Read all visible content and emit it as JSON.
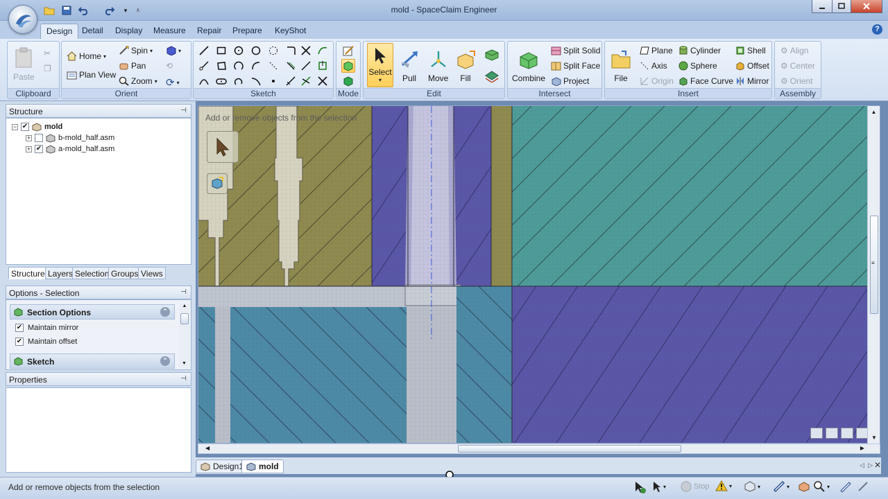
{
  "window": {
    "title": "mold - SpaceClaim Engineer"
  },
  "ribbon_tabs": [
    "Design",
    "Detail",
    "Display",
    "Measure",
    "Repair",
    "Prepare",
    "KeyShot"
  ],
  "clipboard": {
    "paste": "Paste",
    "label": "Clipboard"
  },
  "orient": {
    "home": "Home",
    "plan_view": "Plan View",
    "spin": "Spin",
    "pan": "Pan",
    "zoom": "Zoom",
    "label": "Orient"
  },
  "sketch": {
    "label": "Sketch"
  },
  "mode": {
    "label": "Mode"
  },
  "edit": {
    "select": "Select",
    "pull": "Pull",
    "move": "Move",
    "fill": "Fill",
    "label": "Edit"
  },
  "intersect": {
    "combine": "Combine",
    "split_solid": "Split Solid",
    "split_face": "Split Face",
    "project": "Project",
    "label": "Intersect"
  },
  "insert": {
    "file": "File",
    "plane": "Plane",
    "axis": "Axis",
    "origin": "Origin",
    "cylinder": "Cylinder",
    "sphere": "Sphere",
    "face_curve": "Face Curve",
    "shell": "Shell",
    "offset": "Offset",
    "mirror": "Mirror",
    "label": "Insert"
  },
  "assembly": {
    "align": "Align",
    "center": "Center",
    "orient": "Orient",
    "label": "Assembly"
  },
  "structure_panel": {
    "title": "Structure",
    "tree": [
      {
        "label": "mold",
        "checked": true
      },
      {
        "label": "b-mold_half.asm",
        "checked": false
      },
      {
        "label": "a-mold_half.asm",
        "checked": true
      }
    ],
    "tabs": [
      "Structure",
      "Layers",
      "Selection",
      "Groups",
      "Views"
    ]
  },
  "options_panel": {
    "title": "Options - Selection",
    "section_options": "Section Options",
    "maintain_mirror": "Maintain mirror",
    "maintain_offset": "Maintain offset",
    "sketch": "Sketch"
  },
  "properties_panel": {
    "title": "Properties"
  },
  "viewport": {
    "hint": "Add or remove objects from the selection"
  },
  "doc_tabs": [
    "Design1",
    "mold"
  ],
  "status": {
    "text": "Add or remove objects from the selection",
    "stop": "Stop"
  },
  "colors": {
    "olive": "#8f8a4f",
    "purple": "#5a57a8",
    "teal": "#4e9c9a",
    "steel": "#4d8aa6",
    "light": "#bfc5cf"
  }
}
